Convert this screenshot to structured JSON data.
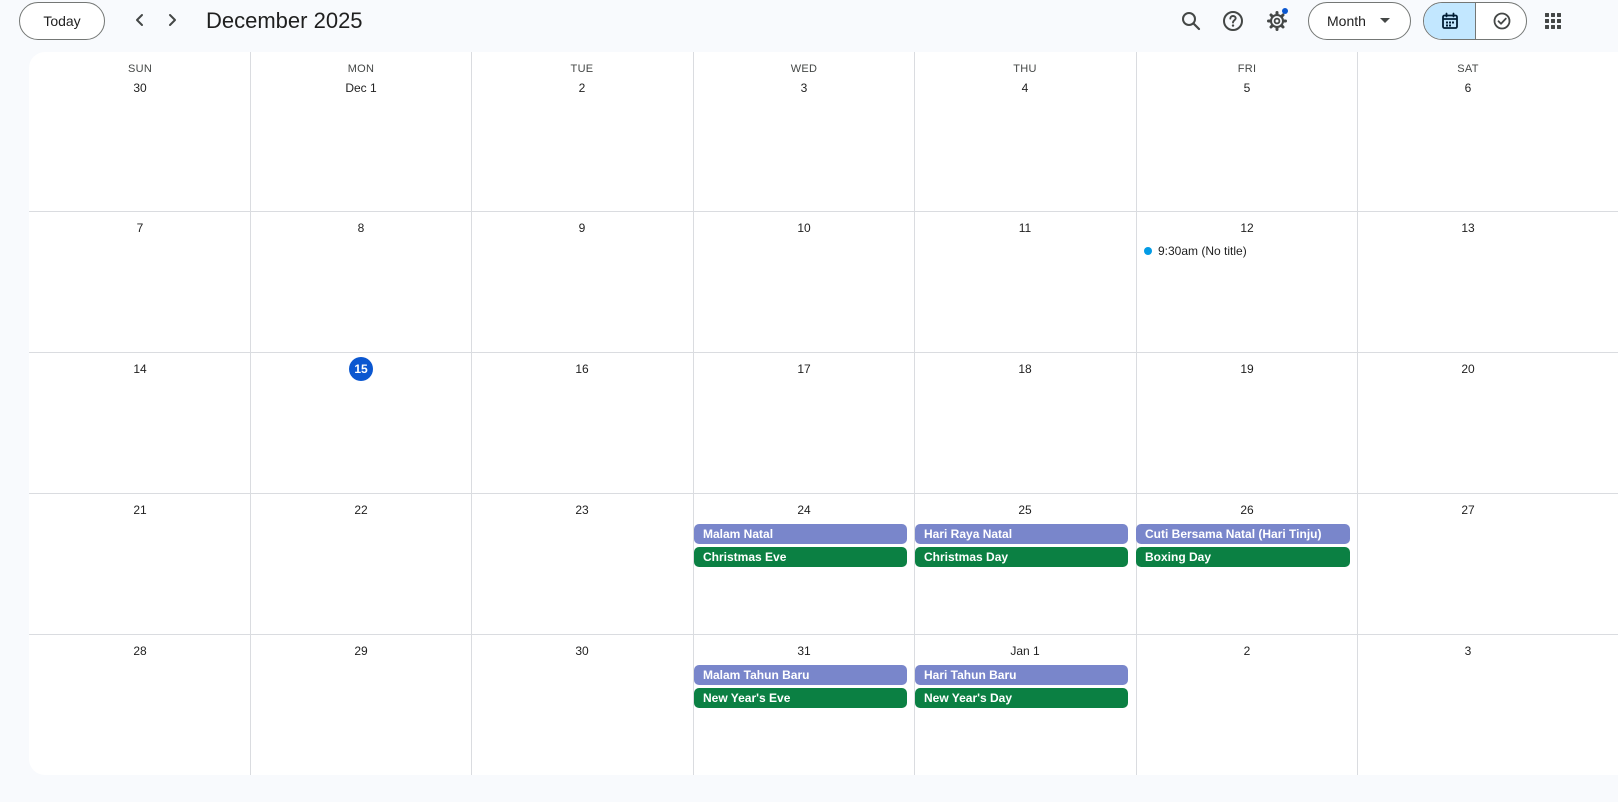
{
  "header": {
    "today_label": "Today",
    "title": "December 2025",
    "view_label": "Month",
    "icons": [
      "chevron-left-icon",
      "chevron-right-icon",
      "search-icon",
      "help-icon",
      "settings-icon",
      "calendar-icon",
      "tasks-icon",
      "apps-grid-icon"
    ]
  },
  "calendar": {
    "days_of_week": [
      "SUN",
      "MON",
      "TUE",
      "WED",
      "THU",
      "FRI",
      "SAT"
    ],
    "today": "15",
    "weeks": [
      [
        "30",
        "Dec 1",
        "2",
        "3",
        "4",
        "5",
        "6"
      ],
      [
        "7",
        "8",
        "9",
        "10",
        "11",
        "12",
        "13"
      ],
      [
        "14",
        "15",
        "16",
        "17",
        "18",
        "19",
        "20"
      ],
      [
        "21",
        "22",
        "23",
        "24",
        "25",
        "26",
        "27"
      ],
      [
        "28",
        "29",
        "30",
        "31",
        "Jan 1",
        "2",
        "3"
      ]
    ],
    "timed_event": {
      "time": "9:30am",
      "title": "(No title)"
    },
    "all_day_events": {
      "w4_wed_1": "Malam Natal",
      "w4_wed_2": "Christmas Eve",
      "w4_thu_1": "Hari Raya Natal",
      "w4_thu_2": "Christmas Day",
      "w4_fri_1": "Cuti Bersama Natal (Hari Tinju)",
      "w4_fri_2": "Boxing Day",
      "w5_wed_1": "Malam Tahun Baru",
      "w5_wed_2": "New Year's Eve",
      "w5_thu_1": "Hari Tahun Baru",
      "w5_thu_2": "New Year's Day"
    }
  },
  "colors": {
    "accent": "#0b57d0",
    "indonesia_holidays": "#7986cb",
    "holidays": "#0b8043",
    "event_dot": "#039be5",
    "selected_view": "#c2e7ff"
  }
}
